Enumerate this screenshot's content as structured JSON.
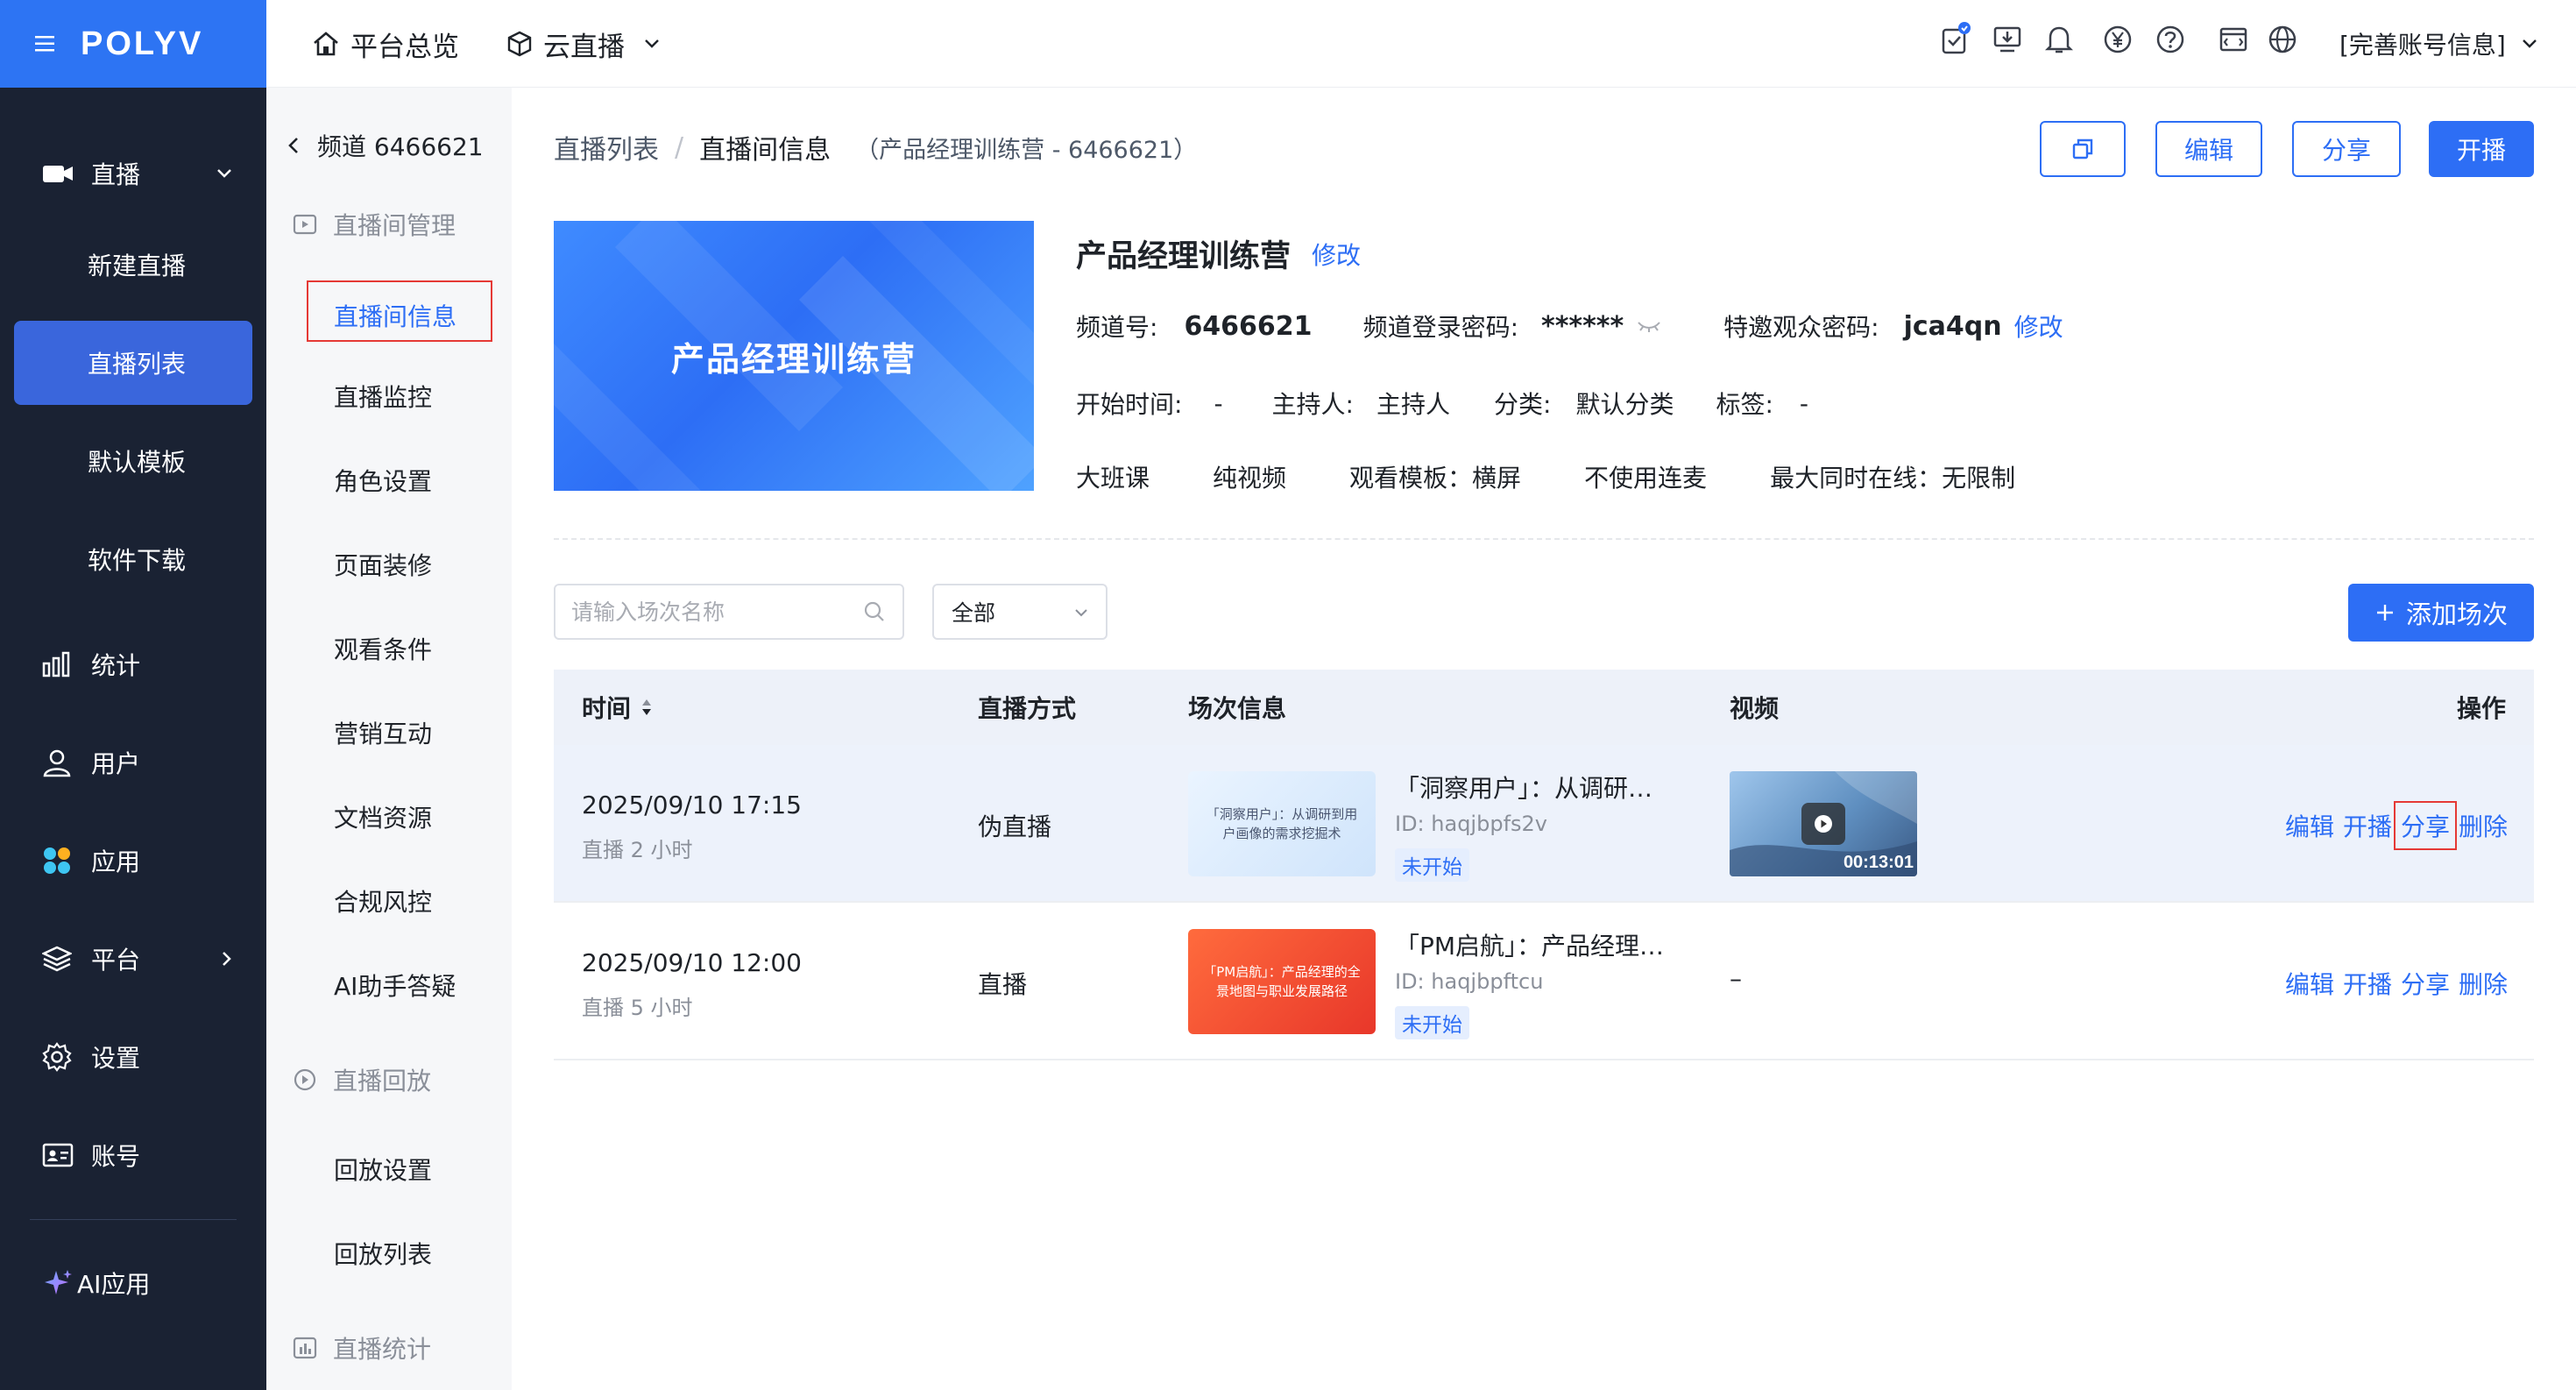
{
  "brand": {
    "logo_text": "POLYV"
  },
  "topbar": {
    "menu": [
      {
        "label": "平台总览"
      },
      {
        "label": "云直播"
      }
    ],
    "account_label": "[完善账号信息]"
  },
  "nav": {
    "live": "直播",
    "live_sub": [
      "新建直播",
      "直播列表",
      "默认模板",
      "软件下载"
    ],
    "items": [
      "统计",
      "用户",
      "应用",
      "平台",
      "设置",
      "账号"
    ],
    "ai": "AI应用"
  },
  "side": {
    "channel": "频道 6466621",
    "group_manage": "直播间管理",
    "manage_items": [
      "直播间信息",
      "直播监控",
      "角色设置",
      "页面装修",
      "观看条件",
      "营销互动",
      "文档资源",
      "合规风控",
      "AI助手答疑"
    ],
    "group_playback": "直播回放",
    "playback_items": [
      "回放设置",
      "回放列表"
    ],
    "group_stats": "直播统计"
  },
  "breadcrumb": {
    "parent": "直播列表",
    "sep": "/",
    "current": "直播间信息",
    "extra": "（产品经理训练营 - 6466621）"
  },
  "header_buttons": {
    "edit": "编辑",
    "share": "分享",
    "start": "开播"
  },
  "room": {
    "cover_title": "产品经理训练营",
    "title": "产品经理训练营",
    "modify": "修改",
    "channel_no_label": "频道号:",
    "channel_no": "6466621",
    "login_pwd_label": "频道登录密码:",
    "login_pwd": "******",
    "invite_pwd_label": "特邀观众密码:",
    "invite_pwd": "jca4qn",
    "invite_modify": "修改",
    "start_time_label": "开始时间:",
    "start_time": "-",
    "host_label": "主持人:",
    "host": "主持人",
    "category_label": "分类:",
    "category": "默认分类",
    "tags_label": "标签:",
    "tags": "-",
    "props": [
      "大班课",
      "纯视频",
      "观看模板：横屏",
      "不使用连麦",
      "最大同时在线：无限制"
    ]
  },
  "filters": {
    "search_placeholder": "请输入场次名称",
    "select_value": "全部",
    "add_button": "添加场次"
  },
  "table": {
    "headers": {
      "time": "时间",
      "mode": "直播方式",
      "info": "场次信息",
      "video": "视频",
      "ops": "操作"
    },
    "rows": [
      {
        "time": "2025/09/10 17:15",
        "duration": "直播 2 小时",
        "mode": "伪直播",
        "thumb_text": "「洞察用户」：从调研到用户画像的需求挖掘术",
        "title": "「洞察用户」：从调研…",
        "id": "ID: haqjbpfs2v",
        "status": "未开始",
        "video_duration": "00:13:01",
        "ops": [
          "编辑",
          "开播",
          "分享",
          "删除"
        ]
      },
      {
        "time": "2025/09/10 12:00",
        "duration": "直播 5 小时",
        "mode": "直播",
        "thumb_text": "「PM启航」：产品经理的全景地图与职业发展路径",
        "title": "「PM启航」：产品经理…",
        "id": "ID: haqjbpftcu",
        "status": "未开始",
        "video": "–",
        "ops": [
          "编辑",
          "开播",
          "分享",
          "删除"
        ]
      }
    ]
  },
  "colors": {
    "primary": "#2d6ef5",
    "nav_bg": "#1a2233",
    "brand_bg": "#2d74f3",
    "highlight": "#e53935"
  }
}
